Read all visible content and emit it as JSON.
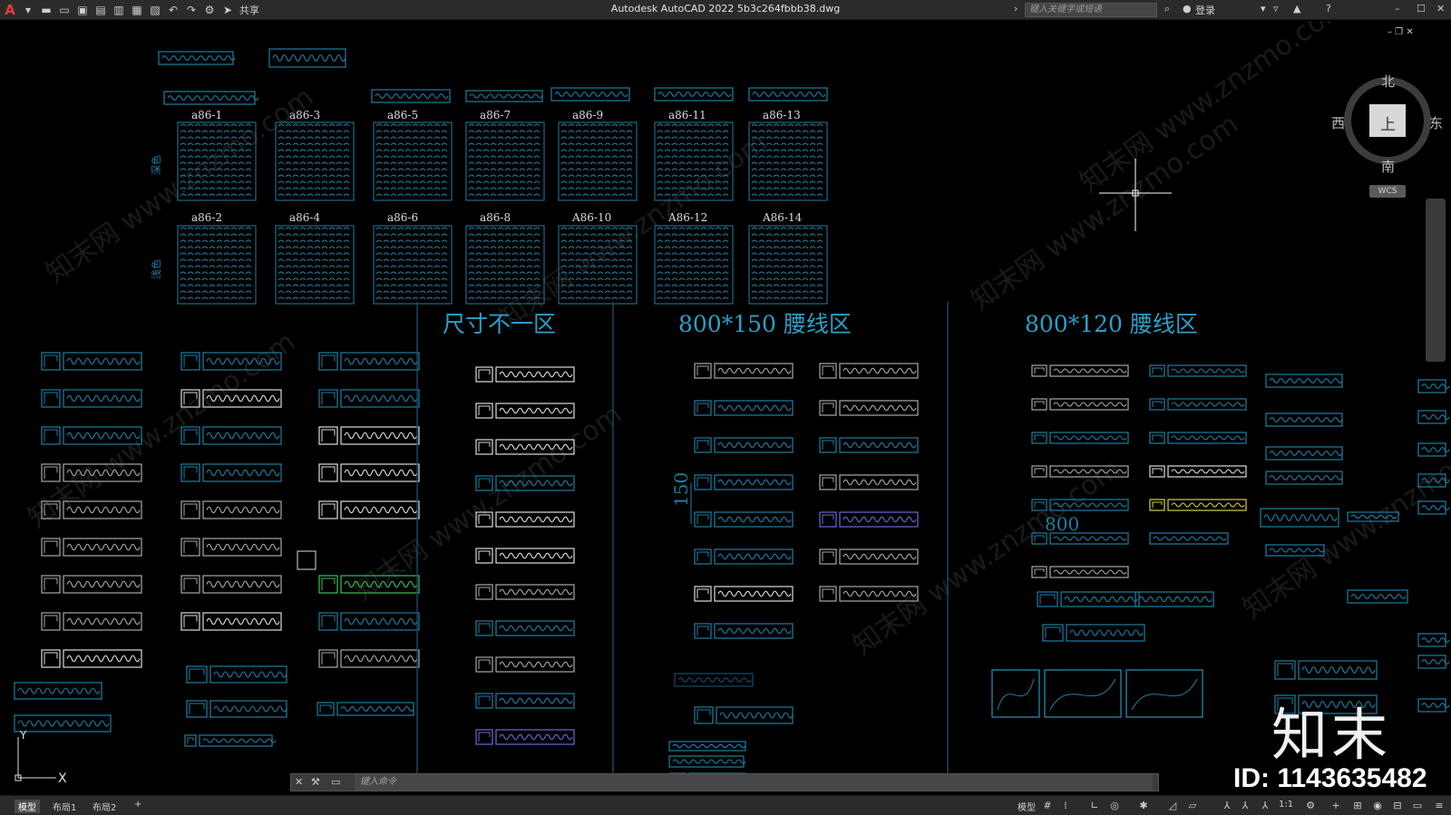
{
  "titlebar": {
    "app_icon": "A",
    "title": "Autodesk AutoCAD 2022    5b3c264fbbb38.dwg",
    "share_label": "共享",
    "search_placeholder": "键入关键字或短语",
    "login_label": "登录",
    "icons": [
      "new-icon",
      "open-icon",
      "save-icon",
      "saveas-icon",
      "plot-preview-icon",
      "publish-icon",
      "print-icon",
      "undo-icon",
      "redo-icon",
      "workspace-icon",
      "share-icon"
    ]
  },
  "viewcube": {
    "north": "北",
    "south": "南",
    "east": "东",
    "west": "西",
    "face": "上",
    "wcs": "WCS"
  },
  "drawing": {
    "zone_labels": [
      "尺寸不一区",
      "800*150  腰线区",
      "800*120  腰线区"
    ],
    "tile_labels_top": [
      "a86-1",
      "a86-3",
      "a86-5",
      "a86-7",
      "a86-9",
      "a86-11",
      "a86-13"
    ],
    "tile_labels_bottom": [
      "a86-2",
      "a86-4",
      "a86-6",
      "a86-8",
      "A86-10",
      "A86-12",
      "A86-14"
    ],
    "side_labels": [
      "深色",
      "浅色"
    ],
    "dim_150": "150",
    "dim_800": "800",
    "watermark": "知末网 www.znzmo.com"
  },
  "commandline": {
    "placeholder": "键入命令"
  },
  "statusbar": {
    "tabs": [
      "模型",
      "布局1",
      "布局2"
    ],
    "add_tab": "+",
    "model_label": "模型",
    "scale": "1:1"
  },
  "brand": {
    "name": "知末",
    "id": "ID: 1143635482"
  },
  "colors": {
    "cyan": "#1f7fa3",
    "cyan_light": "#2aa0c8",
    "gray": "#a8a8a8",
    "white": "#dcdcdc",
    "green": "#3bbf5a",
    "yellow": "#d8d040",
    "purple": "#6a6ad8"
  }
}
